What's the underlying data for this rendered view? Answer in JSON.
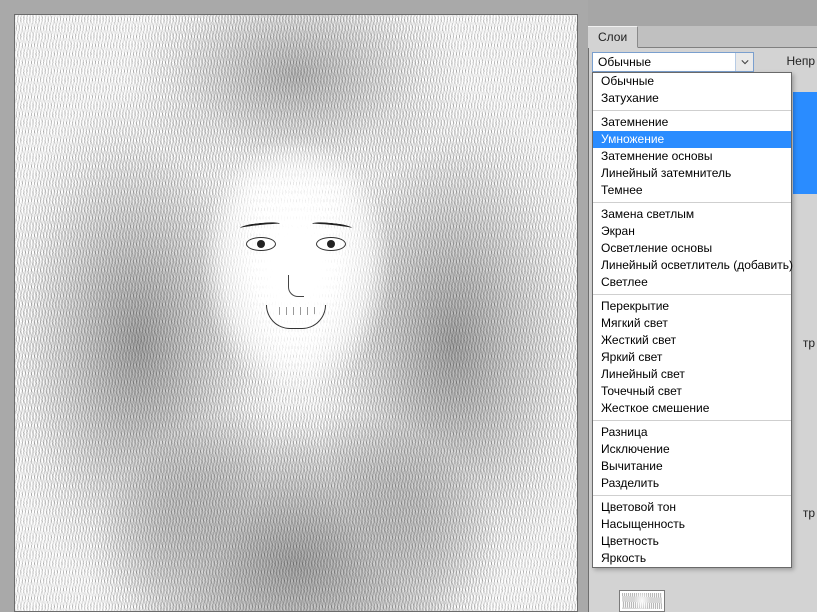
{
  "panel": {
    "tab_layers": "Слои"
  },
  "opacity_label_stub": "Непр",
  "filters_label_stub": "тр",
  "blend_mode": {
    "current": "Обычные",
    "highlighted": "Умножение",
    "groups": [
      [
        "Обычные",
        "Затухание"
      ],
      [
        "Затемнение",
        "Умножение",
        "Затемнение основы",
        "Линейный затемнитель",
        "Темнее"
      ],
      [
        "Замена светлым",
        "Экран",
        "Осветление основы",
        "Линейный осветлитель (добавить)",
        "Светлее"
      ],
      [
        "Перекрытие",
        "Мягкий свет",
        "Жесткий свет",
        "Яркий свет",
        "Линейный свет",
        "Точечный свет",
        "Жесткое смешение"
      ],
      [
        "Разница",
        "Исключение",
        "Вычитание",
        "Разделить"
      ],
      [
        "Цветовой тон",
        "Насыщенность",
        "Цветность",
        "Яркость"
      ]
    ]
  }
}
